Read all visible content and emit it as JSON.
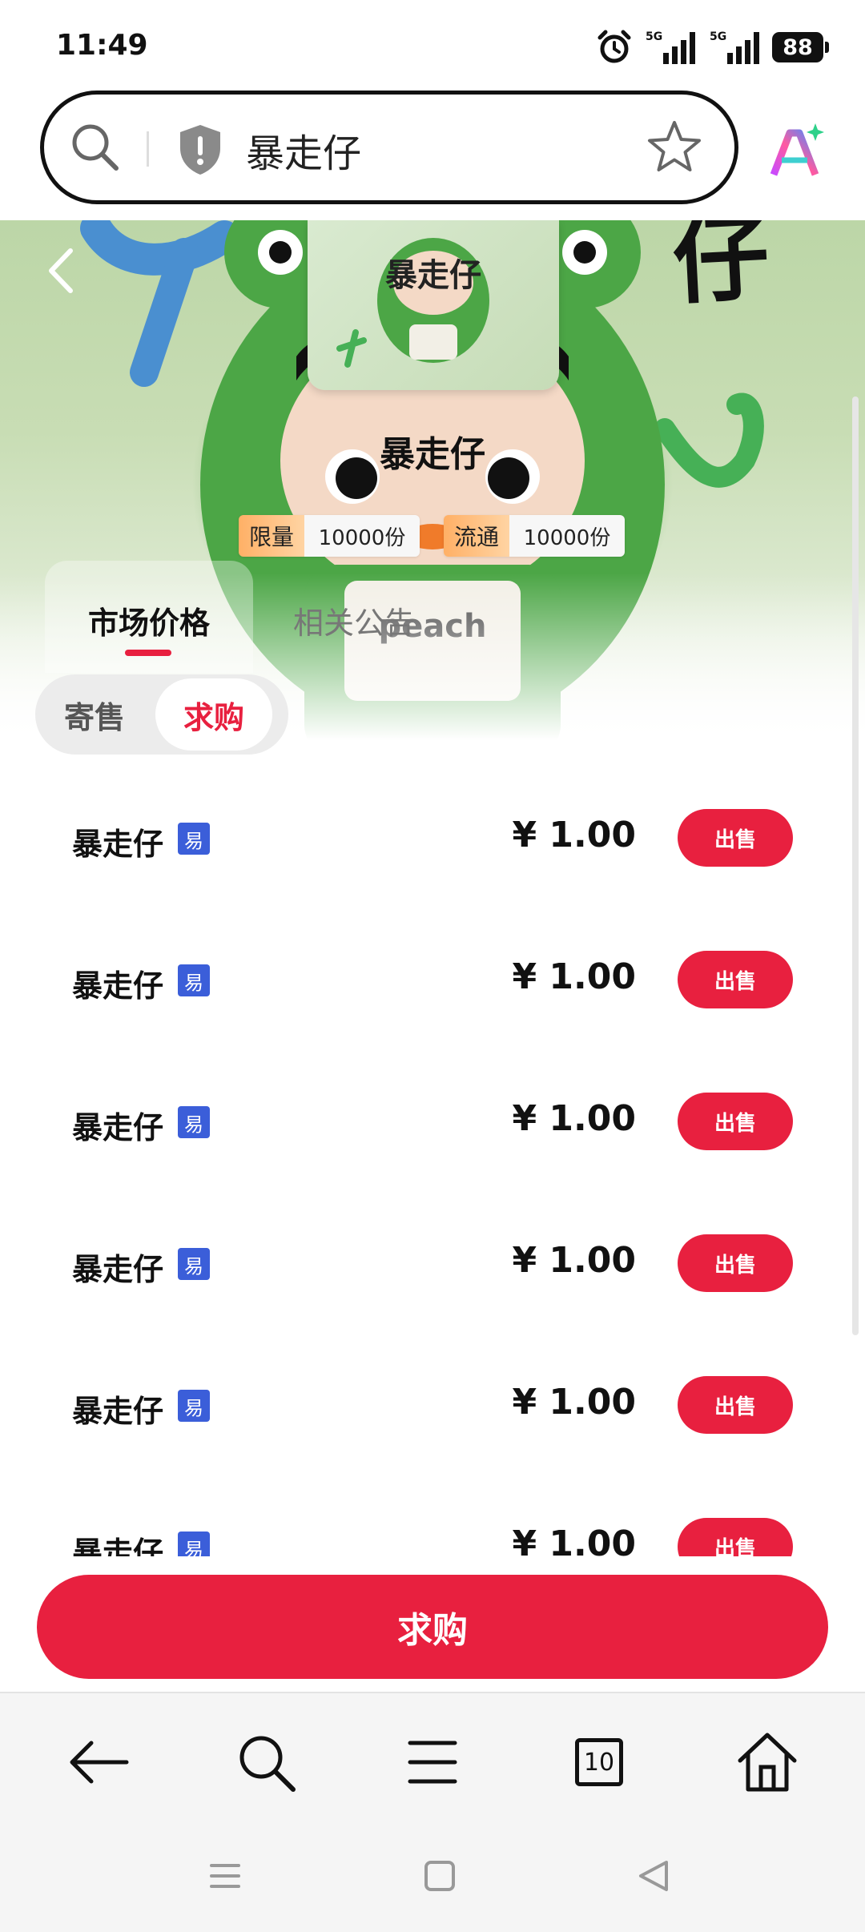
{
  "status_bar": {
    "time": "11:49",
    "battery": "88",
    "network_labels": [
      "5G",
      "5G"
    ]
  },
  "browser": {
    "query": "暴走仔"
  },
  "hero": {
    "thumbnail_title": "暴走仔",
    "deco_text": "仔",
    "product_name": "暴走仔",
    "tags": [
      {
        "key": "限量",
        "value": "10000份"
      },
      {
        "key": "流通",
        "value": "10000份"
      }
    ],
    "tabs": [
      {
        "label": "市场价格",
        "active": true
      },
      {
        "label": "相关公告",
        "active": false
      }
    ]
  },
  "toggle": {
    "consign": "寄售",
    "purchase": "求购",
    "active": "purchase"
  },
  "list": {
    "rows": [
      {
        "name": "暴走仔",
        "badge": "易",
        "price": "¥ 1.00",
        "action": "出售"
      },
      {
        "name": "暴走仔",
        "badge": "易",
        "price": "¥ 1.00",
        "action": "出售"
      },
      {
        "name": "暴走仔",
        "badge": "易",
        "price": "¥ 1.00",
        "action": "出售"
      },
      {
        "name": "暴走仔",
        "badge": "易",
        "price": "¥ 1.00",
        "action": "出售"
      },
      {
        "name": "暴走仔",
        "badge": "易",
        "price": "¥ 1.00",
        "action": "出售"
      },
      {
        "name": "暴走仔",
        "badge": "易",
        "price": "¥ 1.00",
        "action": "出售"
      }
    ]
  },
  "buy_button": {
    "label": "求购"
  },
  "toolbar": {
    "tab_count": "10"
  },
  "colors": {
    "accent": "#e8203f",
    "badge": "#3b5ed9",
    "tag_key": "#ffb066"
  },
  "icons": [
    "alarm-icon",
    "signal-icon",
    "battery-icon",
    "search-icon",
    "shield-icon",
    "star-icon",
    "ai-icon",
    "back-chevron-icon",
    "back-arrow-icon",
    "menu-icon",
    "tabs-icon",
    "home-icon"
  ]
}
